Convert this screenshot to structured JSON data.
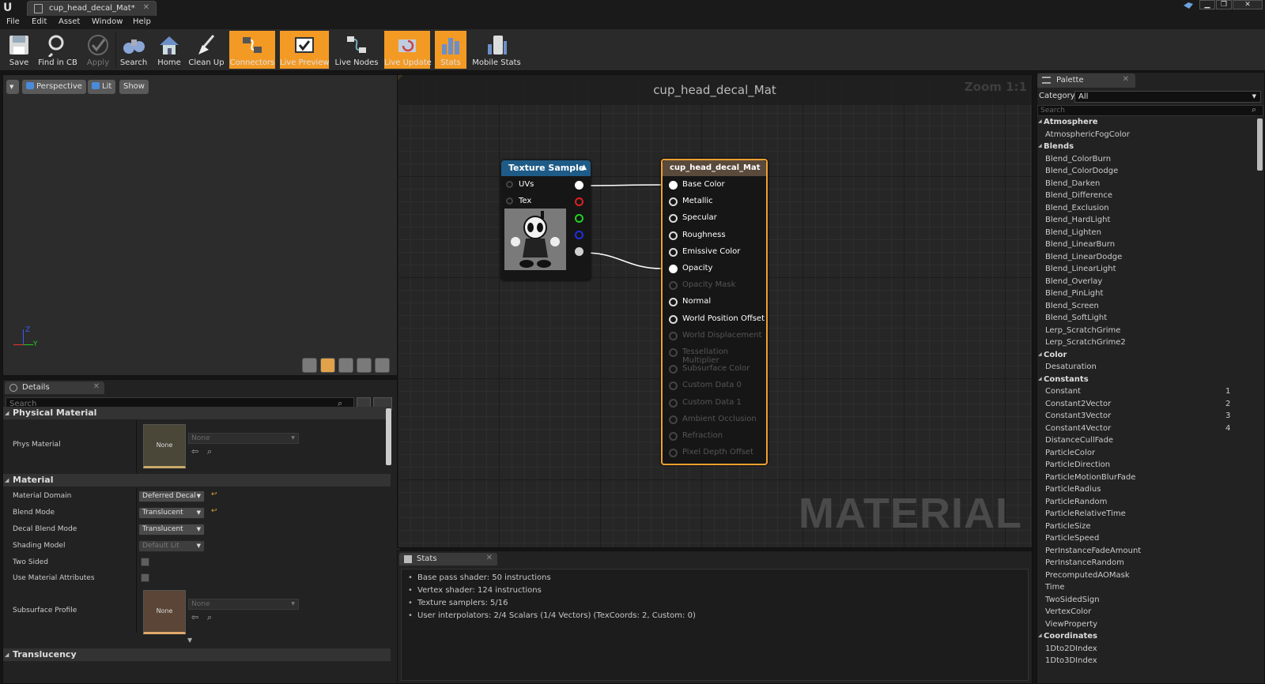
{
  "window": {
    "tab_title": "cup_head_decal_Mat*",
    "controls": [
      "▁",
      "❐",
      "✕"
    ]
  },
  "menu": [
    "File",
    "Edit",
    "Asset",
    "Window",
    "Help"
  ],
  "toolbar": [
    {
      "label": "Save",
      "icon": "save-icon",
      "active": false,
      "disabled": false
    },
    {
      "label": "Find in CB",
      "icon": "magnifier-icon",
      "active": false,
      "disabled": false
    },
    {
      "label": "Apply",
      "icon": "checkmark-icon",
      "active": false,
      "disabled": true
    },
    {
      "label": "Search",
      "icon": "binoculars-icon",
      "active": false,
      "disabled": false
    },
    {
      "label": "Home",
      "icon": "home-icon",
      "active": false,
      "disabled": false
    },
    {
      "label": "Clean Up",
      "icon": "broom-icon",
      "active": false,
      "disabled": false
    },
    {
      "label": "Connectors",
      "icon": "connectors-icon",
      "active": true,
      "disabled": false
    },
    {
      "label": "Live Preview",
      "icon": "preview-checkbox-icon",
      "active": true,
      "disabled": false
    },
    {
      "label": "Live Nodes",
      "icon": "nodes-icon",
      "active": false,
      "disabled": false
    },
    {
      "label": "Live Update",
      "icon": "refresh-icon",
      "active": true,
      "disabled": false
    },
    {
      "label": "Stats",
      "icon": "stats-icon",
      "active": true,
      "disabled": false
    },
    {
      "label": "Mobile Stats",
      "icon": "mobile-stats-icon",
      "active": false,
      "disabled": false
    }
  ],
  "viewport": {
    "perspective_label": "Perspective",
    "lit_label": "Lit",
    "show_label": "Show",
    "axis_z": "Z",
    "axis_y": "Y"
  },
  "details": {
    "tab_label": "Details",
    "search_placeholder": "Search",
    "sections": {
      "physical_material": "Physical Material",
      "material": "Material",
      "translucency": "Translucency"
    },
    "phys_material": {
      "label": "Phys Material",
      "thumb": "None",
      "combo": "None"
    },
    "material_domain": {
      "label": "Material Domain",
      "value": "Deferred Decal"
    },
    "blend_mode": {
      "label": "Blend Mode",
      "value": "Translucent"
    },
    "decal_blend_mode": {
      "label": "Decal Blend Mode",
      "value": "Translucent"
    },
    "shading_model": {
      "label": "Shading Model",
      "value": "Default Lit"
    },
    "two_sided": {
      "label": "Two Sided"
    },
    "use_material_attributes": {
      "label": "Use Material Attributes"
    },
    "subsurface_profile": {
      "label": "Subsurface Profile",
      "thumb": "None",
      "combo": "None"
    }
  },
  "graph": {
    "title": "cup_head_decal_Mat",
    "zoom": "Zoom 1:1",
    "watermark": "MATERIAL",
    "texture_node": {
      "title": "Texture Sample",
      "inputs": [
        "UVs",
        "Tex"
      ],
      "output_colors": [
        "#ffffff",
        "#e02020",
        "#20d020",
        "#2030e0",
        "#d0d0d0"
      ],
      "header_color": "#1e5c87"
    },
    "material_node": {
      "title": "cup_head_decal_Mat",
      "header_color": "#5a4a3c",
      "border_color": "#f0a030",
      "pins": [
        {
          "label": "Base Color",
          "enabled": true,
          "connected": true
        },
        {
          "label": "Metallic",
          "enabled": true,
          "connected": false
        },
        {
          "label": "Specular",
          "enabled": true,
          "connected": false
        },
        {
          "label": "Roughness",
          "enabled": true,
          "connected": false
        },
        {
          "label": "Emissive Color",
          "enabled": true,
          "connected": false
        },
        {
          "label": "Opacity",
          "enabled": true,
          "connected": true
        },
        {
          "label": "Opacity Mask",
          "enabled": false,
          "connected": false
        },
        {
          "label": "Normal",
          "enabled": true,
          "connected": false
        },
        {
          "label": "World Position Offset",
          "enabled": true,
          "connected": false
        },
        {
          "label": "World Displacement",
          "enabled": false,
          "connected": false
        },
        {
          "label": "Tessellation Multiplier",
          "enabled": false,
          "connected": false
        },
        {
          "label": "Subsurface Color",
          "enabled": false,
          "connected": false
        },
        {
          "label": "Custom Data 0",
          "enabled": false,
          "connected": false
        },
        {
          "label": "Custom Data 1",
          "enabled": false,
          "connected": false
        },
        {
          "label": "Ambient Occlusion",
          "enabled": false,
          "connected": false
        },
        {
          "label": "Refraction",
          "enabled": false,
          "connected": false
        },
        {
          "label": "Pixel Depth Offset",
          "enabled": false,
          "connected": false
        }
      ]
    }
  },
  "stats": {
    "tab_label": "Stats",
    "lines": [
      "Base pass shader: 50 instructions",
      "Vertex shader: 124 instructions",
      "Texture samplers: 5/16",
      "User interpolators: 2/4 Scalars (1/4 Vectors) (TexCoords: 2, Custom: 0)"
    ]
  },
  "palette": {
    "tab_label": "Palette",
    "category_label": "Category:",
    "category_value": "All",
    "search_placeholder": "Search",
    "entries": [
      {
        "type": "cat",
        "label": "Atmosphere"
      },
      {
        "type": "item",
        "label": "AtmosphericFogColor"
      },
      {
        "type": "cat",
        "label": "Blends"
      },
      {
        "type": "item",
        "label": "Blend_ColorBurn"
      },
      {
        "type": "item",
        "label": "Blend_ColorDodge"
      },
      {
        "type": "item",
        "label": "Blend_Darken"
      },
      {
        "type": "item",
        "label": "Blend_Difference"
      },
      {
        "type": "item",
        "label": "Blend_Exclusion"
      },
      {
        "type": "item",
        "label": "Blend_HardLight"
      },
      {
        "type": "item",
        "label": "Blend_Lighten"
      },
      {
        "type": "item",
        "label": "Blend_LinearBurn"
      },
      {
        "type": "item",
        "label": "Blend_LinearDodge"
      },
      {
        "type": "item",
        "label": "Blend_LinearLight"
      },
      {
        "type": "item",
        "label": "Blend_Overlay"
      },
      {
        "type": "item",
        "label": "Blend_PinLight"
      },
      {
        "type": "item",
        "label": "Blend_Screen"
      },
      {
        "type": "item",
        "label": "Blend_SoftLight"
      },
      {
        "type": "item",
        "label": "Lerp_ScratchGrime"
      },
      {
        "type": "item",
        "label": "Lerp_ScratchGrime2"
      },
      {
        "type": "cat",
        "label": "Color"
      },
      {
        "type": "item",
        "label": "Desaturation"
      },
      {
        "type": "cat",
        "label": "Constants"
      },
      {
        "type": "item",
        "label": "Constant",
        "key": "1"
      },
      {
        "type": "item",
        "label": "Constant2Vector",
        "key": "2"
      },
      {
        "type": "item",
        "label": "Constant3Vector",
        "key": "3"
      },
      {
        "type": "item",
        "label": "Constant4Vector",
        "key": "4"
      },
      {
        "type": "item",
        "label": "DistanceCullFade"
      },
      {
        "type": "item",
        "label": "ParticleColor"
      },
      {
        "type": "item",
        "label": "ParticleDirection"
      },
      {
        "type": "item",
        "label": "ParticleMotionBlurFade"
      },
      {
        "type": "item",
        "label": "ParticleRadius"
      },
      {
        "type": "item",
        "label": "ParticleRandom"
      },
      {
        "type": "item",
        "label": "ParticleRelativeTime"
      },
      {
        "type": "item",
        "label": "ParticleSize"
      },
      {
        "type": "item",
        "label": "ParticleSpeed"
      },
      {
        "type": "item",
        "label": "PerInstanceFadeAmount"
      },
      {
        "type": "item",
        "label": "PerInstanceRandom"
      },
      {
        "type": "item",
        "label": "PrecomputedAOMask"
      },
      {
        "type": "item",
        "label": "Time"
      },
      {
        "type": "item",
        "label": "TwoSidedSign"
      },
      {
        "type": "item",
        "label": "VertexColor"
      },
      {
        "type": "item",
        "label": "ViewProperty"
      },
      {
        "type": "cat",
        "label": "Coordinates"
      },
      {
        "type": "item",
        "label": "1Dto2DIndex"
      },
      {
        "type": "item",
        "label": "1Dto3DIndex"
      }
    ]
  }
}
